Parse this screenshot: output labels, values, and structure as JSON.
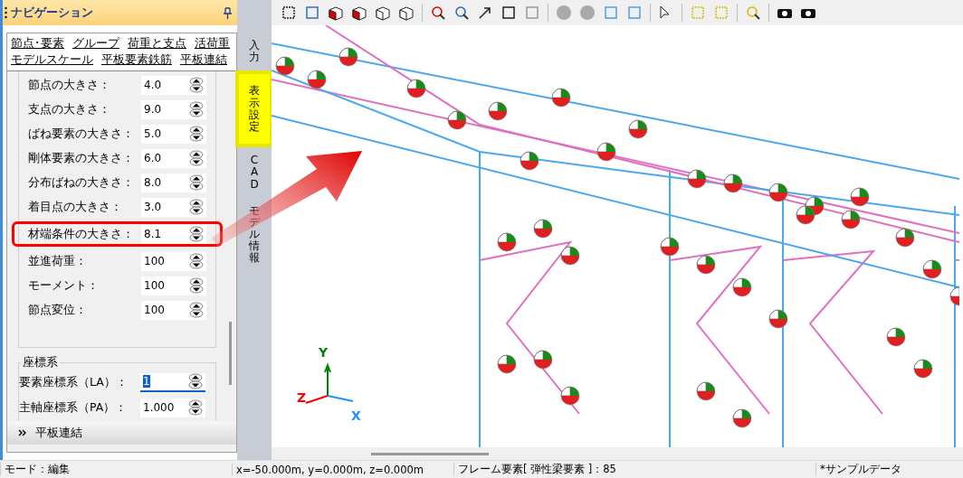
{
  "panel": {
    "title": "ナビゲーション"
  },
  "nav_links": [
    {
      "label": "節点･要素"
    },
    {
      "label": "グループ"
    },
    {
      "label": "荷重と支点"
    },
    {
      "label": "活荷重"
    },
    {
      "label": "モデルスケール"
    },
    {
      "label": "平板要素鉄筋"
    },
    {
      "label": "平板連結"
    }
  ],
  "size_settings": [
    {
      "label": "節点の大きさ：",
      "value": "4.0",
      "highlighted": false
    },
    {
      "label": "支点の大きさ：",
      "value": "9.0",
      "highlighted": false
    },
    {
      "label": "ばね要素の大きさ：",
      "value": "5.0",
      "highlighted": false
    },
    {
      "label": "剛体要素の大きさ：",
      "value": "6.0",
      "highlighted": false
    },
    {
      "label": "分布ばねの大きさ：",
      "value": "8.0",
      "highlighted": false
    },
    {
      "label": "着目点の大きさ：",
      "value": "3.0",
      "highlighted": false
    },
    {
      "label": "材端条件の大きさ：",
      "value": "8.1",
      "highlighted": true
    },
    {
      "label": "並進荷重：",
      "value": "100",
      "highlighted": false
    },
    {
      "label": "モーメント：",
      "value": "100",
      "highlighted": false
    },
    {
      "label": "節点変位：",
      "value": "100",
      "highlighted": false
    }
  ],
  "coordinate_group": {
    "title": "座標系",
    "settings": [
      {
        "label": "要素座標系（LA）：",
        "value": "1",
        "focused": true
      },
      {
        "label": "主軸座標系（PA）：",
        "value": "1.000",
        "focused": false
      }
    ]
  },
  "collapsed_section": {
    "label": "平板連結",
    "expanded": false
  },
  "side_tabs": [
    {
      "label": "入力",
      "selected": false
    },
    {
      "label": "表示設定",
      "selected": true
    },
    {
      "label": "CAD",
      "selected": false
    },
    {
      "label": "モデル情報",
      "selected": false
    }
  ],
  "axes": [
    {
      "label": "Y",
      "color": "#008000"
    },
    {
      "label": "Z",
      "color": "#ff0000"
    },
    {
      "label": "X",
      "color": "#1e90ff"
    }
  ],
  "status_bar": [
    {
      "text": "モード：編集"
    },
    {
      "text": "x=-50.000m, y=0.000m, z=0.000m"
    },
    {
      "text": "フレーム要素[ 弾性梁要素 ]：85"
    },
    {
      "text": "*サンプルデータ"
    }
  ]
}
